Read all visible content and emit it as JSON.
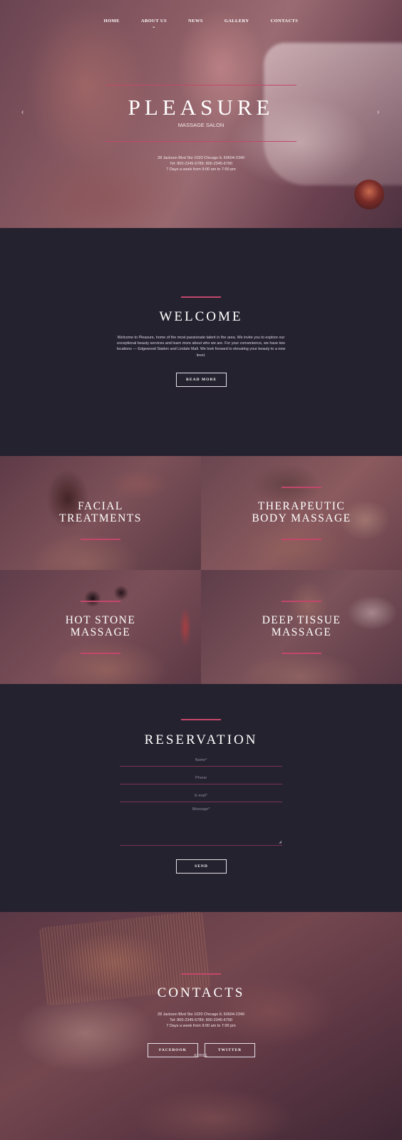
{
  "nav": {
    "items": [
      {
        "label": "HOME"
      },
      {
        "label": "ABOUT US"
      },
      {
        "label": "NEWS"
      },
      {
        "label": "GALLERY"
      },
      {
        "label": "CONTACTS"
      }
    ]
  },
  "hero": {
    "title": "PLEASURE",
    "subtitle": "MASSAGE SALON",
    "address": "28 Jackson Blvd Ste 1020 Chicago IL 60604-2340",
    "phone": "Tel: 800-2345-6789; 800-2345-6790",
    "hours": "7 Days a week from  9:00 am to 7:00 pm",
    "prev_arrow": "‹",
    "next_arrow": "›"
  },
  "welcome": {
    "title": "WELCOME",
    "text": "Welcome to Pleasure, home of the most passionate talent in the area. We invite you to explore our exceptional beauty services and learn more about who we are. For your convenience, we have two locations — Edgewood Station and Lindale Mall. We look forward to elevating your beauty to a new level.",
    "button": "READ MORE"
  },
  "services": [
    {
      "title": "FACIAL\nTREATMENTS"
    },
    {
      "title": "THERAPEUTIC\nBODY MASSAGE"
    },
    {
      "title": "HOT STONE\nMASSAGE"
    },
    {
      "title": "DEEP TISSUE\nMASSAGE"
    }
  ],
  "reservation": {
    "title": "RESERVATION",
    "name_placeholder": "Name*",
    "phone_placeholder": "Phone",
    "email_placeholder": "E-mail*",
    "message_placeholder": "Message*",
    "button": "SEND"
  },
  "contacts": {
    "title": "CONTACTS",
    "address": "28 Jackson Blvd Ste 1020 Chicago IL 60604-2340",
    "phone": "Tel: 800-2345-6789; 800-2345-6790",
    "hours": "7 Days a week from 9:00 am to 7:00 pm",
    "facebook": "FACEBOOK",
    "twitter": "TWITTER",
    "copyright": "© 2016."
  },
  "colors": {
    "accent": "#c2476b",
    "dark_background": "#25222f"
  }
}
